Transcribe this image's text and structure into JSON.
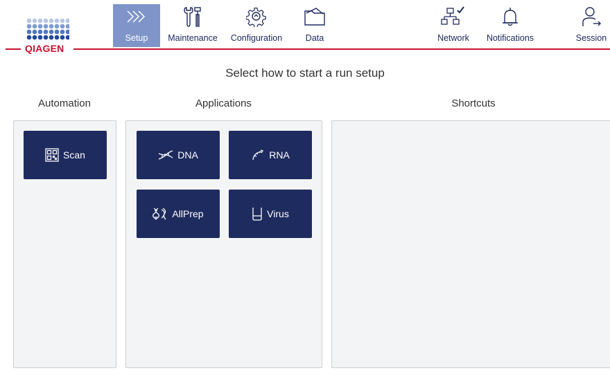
{
  "header": {
    "logo_text": "QIAGEN",
    "nav": [
      {
        "label": "Setup",
        "icon": "chevrons-right-icon",
        "active": true
      },
      {
        "label": "Maintenance",
        "icon": "tools-icon",
        "active": false
      },
      {
        "label": "Configuration",
        "icon": "gear-icon",
        "active": false
      },
      {
        "label": "Data",
        "icon": "folder-icon",
        "active": false
      }
    ],
    "right_nav": [
      {
        "label": "Network",
        "icon": "network-check-icon"
      },
      {
        "label": "Notifications",
        "icon": "bell-icon"
      },
      {
        "label": "Session",
        "icon": "user-logout-icon"
      }
    ]
  },
  "main": {
    "subtitle": "Select how to start a run setup",
    "columns": {
      "automation": "Automation",
      "applications": "Applications",
      "shortcuts": "Shortcuts"
    },
    "automation_tiles": [
      {
        "label": "Scan",
        "icon": "qr-code-icon"
      }
    ],
    "application_tiles": [
      {
        "label": "DNA",
        "icon": "dna-icon"
      },
      {
        "label": "RNA",
        "icon": "rna-icon"
      },
      {
        "label": "AllPrep",
        "icon": "allprep-icon"
      },
      {
        "label": "Virus",
        "icon": "tube-icon"
      }
    ]
  },
  "colors": {
    "accent": "#c8102e",
    "tile": "#1e2b5e",
    "active_nav": "#7f95c9",
    "logo_blue": "#3e6db5"
  }
}
